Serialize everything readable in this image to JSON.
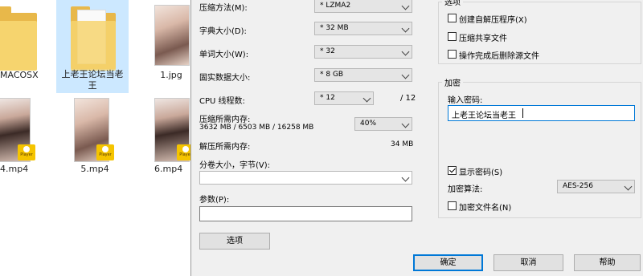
{
  "explorer": {
    "files": [
      {
        "label": "MACOSX"
      },
      {
        "label": "上老王论坛当老王"
      },
      {
        "label": "1.jpg"
      },
      {
        "label": "4.mp4"
      },
      {
        "label": "5.mp4"
      },
      {
        "label": "6.mp4"
      }
    ],
    "badge_text": "Player"
  },
  "dialog": {
    "compress_method": {
      "label": "压缩方法(M):",
      "value": "* LZMA2"
    },
    "dict_size": {
      "label": "字典大小(D):",
      "value": "* 32 MB"
    },
    "word_size": {
      "label": "单词大小(W):",
      "value": "* 32"
    },
    "solid_block": {
      "label": "固实数据大小:",
      "value": "* 8 GB"
    },
    "cpu_threads": {
      "label": "CPU 线程数:",
      "value": "* 12",
      "max": "/ 12"
    },
    "mem_compress": {
      "label": "压缩所需内存:",
      "detail": "3632 MB / 6503 MB / 16258 MB",
      "value": "40%"
    },
    "mem_decompress": {
      "label": "解压所需内存:",
      "value": "34 MB"
    },
    "split_volumes": {
      "label": "分卷大小，字节(V):",
      "value": ""
    },
    "params": {
      "label": "参数(P):",
      "value": ""
    },
    "options_button": "选项",
    "options_group": {
      "title": "选项",
      "items": [
        {
          "label": "创建自解压程序(X)",
          "checked": false
        },
        {
          "label": "压缩共享文件",
          "checked": false
        },
        {
          "label": "操作完成后删除源文件",
          "checked": false
        }
      ]
    },
    "encryption": {
      "title": "加密",
      "password_label": "输入密码:",
      "password_value": "上老王论坛当老王",
      "show_password": {
        "label": "显示密码(S)",
        "checked": true
      },
      "method_label": "加密算法:",
      "method_value": "AES-256",
      "encrypt_names": {
        "label": "加密文件名(N)",
        "checked": false
      }
    },
    "buttons": {
      "ok": "确定",
      "cancel": "取消",
      "help": "帮助"
    }
  }
}
